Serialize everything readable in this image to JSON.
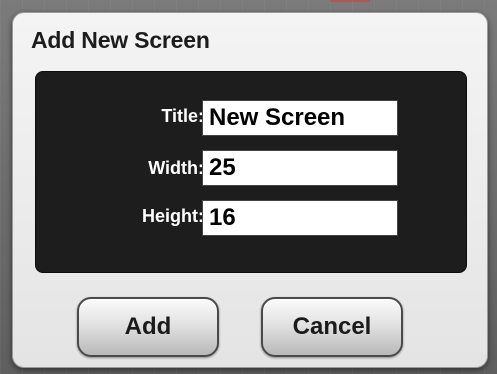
{
  "dialog": {
    "title": "Add New Screen"
  },
  "form": {
    "fields": [
      {
        "label": "Title:",
        "value": "New Screen"
      },
      {
        "label": "Width:",
        "value": "25"
      },
      {
        "label": "Height:",
        "value": "16"
      }
    ]
  },
  "buttons": {
    "add_label": "Add",
    "cancel_label": "Cancel"
  }
}
